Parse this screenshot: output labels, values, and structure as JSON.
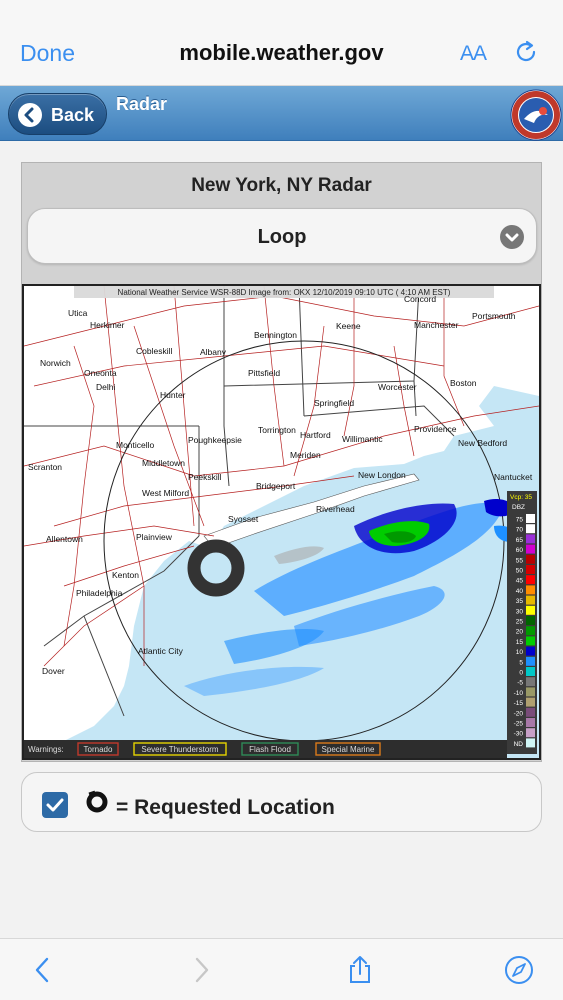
{
  "browser": {
    "done_label": "Done",
    "url": "mobile.weather.gov",
    "text_size_label": "AA"
  },
  "header": {
    "back_label": "Back",
    "title": "Radar"
  },
  "radar": {
    "title": "New York, NY Radar",
    "loop_selected": "Loop",
    "image_banner": "National Weather Service WSR-88D Image from: OKX 12/10/2019 09:10 UTC ( 4:10 AM EST)",
    "warnings_label": "Warnings:",
    "warnings": [
      {
        "label": "Tornado",
        "color": "#c0392b"
      },
      {
        "label": "Severe Thunderstorm",
        "color": "#e6d300"
      },
      {
        "label": "Flash Flood",
        "color": "#2e8b57"
      },
      {
        "label": "Special Marine",
        "color": "#d97a1a"
      }
    ],
    "legend_header": "Vcp: 35",
    "legend_unit": "DBZ",
    "legend": [
      {
        "label": "75",
        "color": "#ffffff"
      },
      {
        "label": "70",
        "color": "#ffffff"
      },
      {
        "label": "65",
        "color": "#9b30d9"
      },
      {
        "label": "60",
        "color": "#d100d1"
      },
      {
        "label": "55",
        "color": "#b80000"
      },
      {
        "label": "50",
        "color": "#d40000"
      },
      {
        "label": "45",
        "color": "#ff0000"
      },
      {
        "label": "40",
        "color": "#ff8c00"
      },
      {
        "label": "35",
        "color": "#e6b800"
      },
      {
        "label": "30",
        "color": "#ffff00"
      },
      {
        "label": "25",
        "color": "#006400"
      },
      {
        "label": "20",
        "color": "#009900"
      },
      {
        "label": "15",
        "color": "#00cc00"
      },
      {
        "label": "10",
        "color": "#0000cc"
      },
      {
        "label": "5",
        "color": "#1e90ff"
      },
      {
        "label": "0",
        "color": "#00c8c8"
      },
      {
        "label": "-5",
        "color": "#777777"
      },
      {
        "label": "-10",
        "color": "#999966"
      },
      {
        "label": "-15",
        "color": "#b0a070"
      },
      {
        "label": "-20",
        "color": "#7a4c7a"
      },
      {
        "label": "-25",
        "color": "#a878a8"
      },
      {
        "label": "-30",
        "color": "#c7a0c7"
      },
      {
        "label": "ND",
        "color": "#d0f5f5"
      }
    ],
    "cities": [
      {
        "name": "Concord"
      },
      {
        "name": "Utica"
      },
      {
        "name": "Herkimer"
      },
      {
        "name": "Portsmouth"
      },
      {
        "name": "Bennington"
      },
      {
        "name": "Keene"
      },
      {
        "name": "Manchester"
      },
      {
        "name": "Cobleskill"
      },
      {
        "name": "Albany"
      },
      {
        "name": "Norwich"
      },
      {
        "name": "Oneonta"
      },
      {
        "name": "Pittsfield"
      },
      {
        "name": "Delhi"
      },
      {
        "name": "Worcester"
      },
      {
        "name": "Boston"
      },
      {
        "name": "Hunter"
      },
      {
        "name": "Springfield"
      },
      {
        "name": "Torrington"
      },
      {
        "name": "Hartford"
      },
      {
        "name": "Providence"
      },
      {
        "name": "Willimantic"
      },
      {
        "name": "Monticello"
      },
      {
        "name": "Poughkeepsie"
      },
      {
        "name": "New Bedford"
      },
      {
        "name": "Meriden"
      },
      {
        "name": "Middletown"
      },
      {
        "name": "Scranton"
      },
      {
        "name": "New London"
      },
      {
        "name": "Nantucket"
      },
      {
        "name": "Peekskill"
      },
      {
        "name": "Bridgeport"
      },
      {
        "name": "West Milford"
      },
      {
        "name": "Riverhead"
      },
      {
        "name": "Syosset"
      },
      {
        "name": "Allentown"
      },
      {
        "name": "Plainview"
      },
      {
        "name": "Kenton"
      },
      {
        "name": "Philadelphia"
      },
      {
        "name": "Atlantic City"
      },
      {
        "name": "Dover"
      }
    ]
  },
  "location_row": {
    "checked": true,
    "label": "= Requested Location"
  }
}
